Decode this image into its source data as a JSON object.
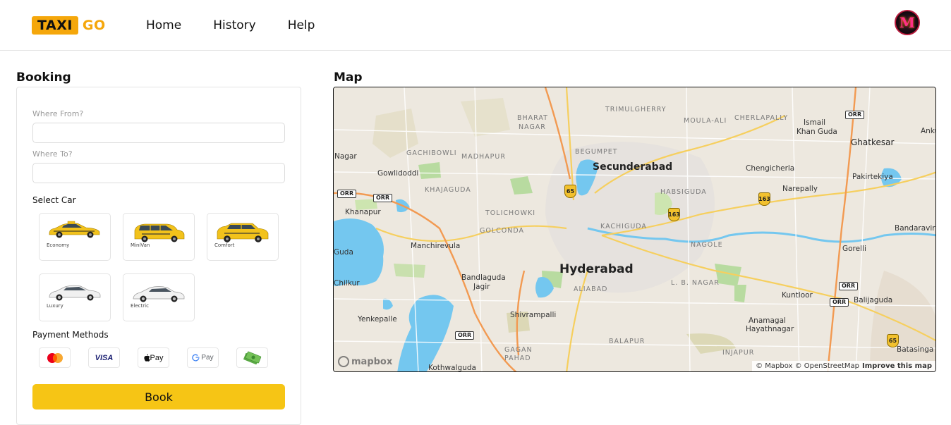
{
  "header": {
    "logo_taxi": "TAXI",
    "logo_go": "GO",
    "nav": [
      "Home",
      "History",
      "Help"
    ],
    "avatar_letter": "M"
  },
  "booking": {
    "title": "Booking",
    "from_label": "Where From?",
    "from_value": "",
    "to_label": "Where To?",
    "to_value": "",
    "select_car_label": "Select Car",
    "cars": [
      {
        "label": "Economy",
        "icon": "taxi-car-icon",
        "color": "#f2c21b"
      },
      {
        "label": "MiniVan",
        "icon": "minivan-icon",
        "color": "#f2c21b"
      },
      {
        "label": "Comfort",
        "icon": "suv-icon",
        "color": "#f2c21b"
      },
      {
        "label": "Luxury",
        "icon": "luxury-car-icon",
        "color": "#e8e8e8"
      },
      {
        "label": "Electric",
        "icon": "electric-car-icon",
        "color": "#e8e8e8"
      }
    ],
    "payment_label": "Payment Methods",
    "payments": [
      {
        "name": "Mastercard",
        "icon": "mastercard-icon"
      },
      {
        "name": "VISA",
        "icon": "visa-icon"
      },
      {
        "name": "Pay",
        "icon": "apple-pay-icon"
      },
      {
        "name": "Pay",
        "icon": "google-pay-icon"
      },
      {
        "name": "Cash",
        "icon": "cash-icon"
      }
    ],
    "book_label": "Book",
    "accent_color": "#f6c515"
  },
  "map": {
    "title": "Map",
    "labels": {
      "secunderabad": "Secunderabad",
      "hyderabad": "Hyderabad",
      "trimulgherry": "TRIMULGHERRY",
      "moulaali": "MOULA-ALI",
      "cherlapally": "CHERLAPALLY",
      "ismail": "Ismail",
      "khanguda": "Khan Guda",
      "ghatkesar": "Ghatkesar",
      "bharatnagar1": "BHARAT",
      "bharatnagar2": "NAGAR",
      "begumpet": "BEGUMPET",
      "gachibowli": "GACHIBOWLI",
      "madhapur": "MADHAPUR",
      "nagar": "Nagar",
      "gowlidoddi": "Gowlidoddi",
      "khajaguda": "KHAJAGUDA",
      "habsiguda": "HABSIGUDA",
      "chengicherla": "Chengicherla",
      "pakirtekiya": "Pakirtekiya",
      "narepally": "Narepally",
      "khanapur": "Khanapur",
      "tolichowki": "TOLICHOWKI",
      "golconda": "GOLCONDA",
      "kachiguda": "KACHIGUDA",
      "bandaraviryala": "Bandaraviryala",
      "manchirevula": "Manchirevula",
      "nagole": "NAGOLE",
      "gorelli": "Gorelli",
      "guda": "Guda",
      "bandlaguda1": "Bandlaguda",
      "bandlaguda2": "Jagir",
      "chilkur": "Chilkur",
      "aliabad": "ALIABAD",
      "lbnagar": "L. B. NAGAR",
      "kuntloor": "Kuntloor",
      "balijaguda": "Balijaguda",
      "shivrampalli": "Shivrampalli",
      "yenkepalle": "Yenkepalle",
      "anamagal": "Anamagal",
      "hayathnagar": "Hayathnagar",
      "balapur": "BALAPUR",
      "injapur": "INJAPUR",
      "gaganpahad1": "GAGAN",
      "gaganpahad2": "PAHAD",
      "kothwalguda": "Kothwalguda",
      "batasinga": "Batasinga",
      "anku": "Anku",
      "orr": "ORR",
      "nh65": "65",
      "nh163": "163"
    },
    "mapbox_logo": "mapbox",
    "attribution": "© Mapbox © OpenStreetMap",
    "improve": "Improve this map"
  }
}
